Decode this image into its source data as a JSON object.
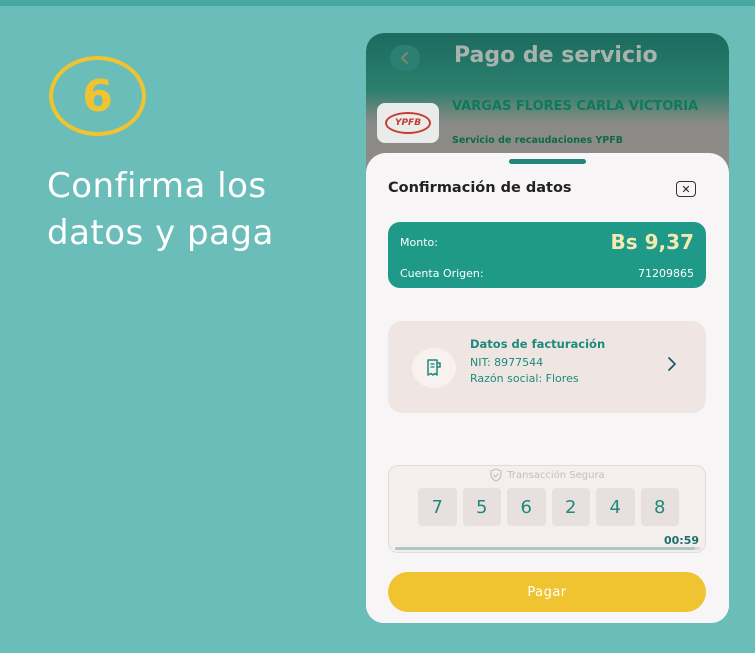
{
  "step": {
    "number": "6",
    "headline_line1": "Confirma los",
    "headline_line2": "datos y paga"
  },
  "app": {
    "title": "Pago de servicio",
    "merchant": {
      "logo_text": "YPFB",
      "name": "VARGAS FLORES CARLA VICTORIA",
      "service": "Servicio de recaudaciones YPFB"
    }
  },
  "sheet": {
    "title": "Confirmación de datos",
    "amount": {
      "label": "Monto:",
      "value": "Bs 9,37",
      "origin_label": "Cuenta Origen:",
      "origin_value": "71209865"
    },
    "billing": {
      "title": "Datos de facturación",
      "nit": "NIT: 8977544",
      "razon": "Razón social: Flores"
    },
    "secure": {
      "label": "Transacción Segura",
      "digits": [
        "7",
        "5",
        "6",
        "2",
        "4",
        "8"
      ],
      "timer": "00:59",
      "progress": 0.98
    },
    "pay_button": "Pagar"
  },
  "colors": {
    "accent_yellow": "#f0c430",
    "teal": "#1f9a89",
    "background": "#6bbdb9"
  },
  "icons": {
    "back": "chevron-left-icon",
    "close": "close-icon",
    "billing": "receipt-icon",
    "chevron": "chevron-right-icon",
    "shield": "shield-check-icon"
  }
}
